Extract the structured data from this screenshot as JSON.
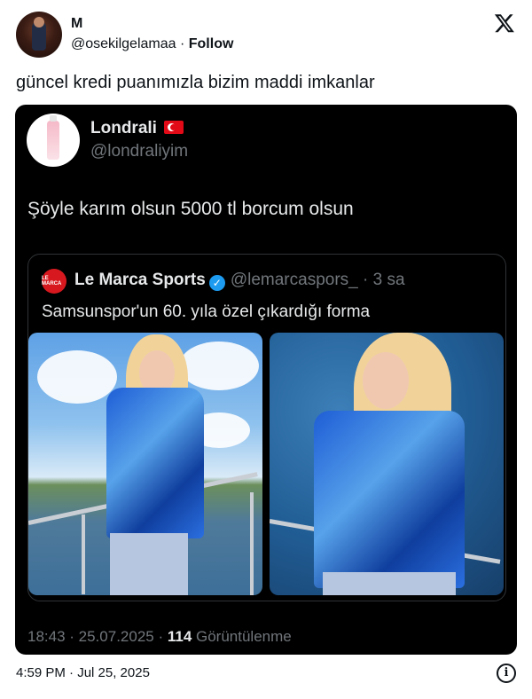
{
  "post": {
    "author_name": "M",
    "author_handle": "@osekilgelamaa",
    "separator": " · ",
    "follow_label": "Follow",
    "text": "güncel kredi puanımızla bizim maddi imkanlar",
    "timestamp": "4:59 PM · Jul 25, 2025"
  },
  "quoted": {
    "author_name": "Londrali",
    "author_handle": "@londraliyim",
    "text": "Şöyle karım olsun 5000 tl borcum olsun",
    "meta_prefix": "18:43 · 25.07.2025 · ",
    "views_count": "114",
    "views_label": " Görüntülenme",
    "inner": {
      "logo_text": "LE MARCA",
      "author_name": "Le Marca Sports",
      "author_handle": "@lemarcaspors_",
      "age": " · 3 sa",
      "text": "Samsunspor'un 60. yıla özel çıkardığı forma"
    }
  },
  "icons": [
    "x-logo-icon",
    "turkish-flag-icon",
    "verified-icon",
    "info-icon"
  ],
  "colors": {
    "dark_card": "#000000",
    "muted": "#71767b",
    "verified": "#1d9bf0",
    "flag": "#e30a17"
  }
}
